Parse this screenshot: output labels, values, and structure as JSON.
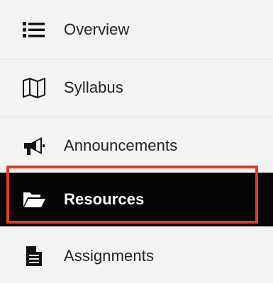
{
  "nav": {
    "items": [
      {
        "label": "Overview",
        "icon": "list-icon"
      },
      {
        "label": "Syllabus",
        "icon": "map-icon"
      },
      {
        "label": "Announcements",
        "icon": "megaphone-icon"
      },
      {
        "label": "Resources",
        "icon": "folder-open-icon",
        "active": true
      },
      {
        "label": "Assignments",
        "icon": "document-icon"
      }
    ]
  },
  "colors": {
    "background": "#f3f3f3",
    "active_background": "#050505",
    "highlight_outline": "#e8391f",
    "text": "#222222",
    "active_text": "#ffffff"
  }
}
